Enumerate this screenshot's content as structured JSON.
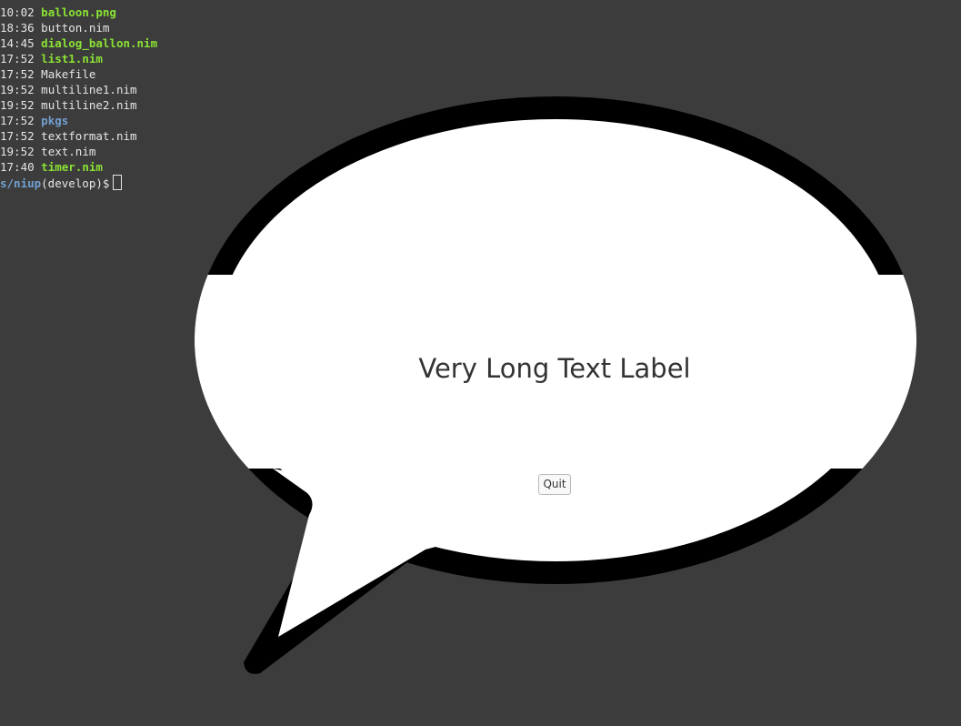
{
  "terminal": {
    "lines": [
      {
        "time": "10:02",
        "name": "balloon.png",
        "kind": "exec"
      },
      {
        "time": "18:36",
        "name": "button.nim",
        "kind": "plain"
      },
      {
        "time": "14:45",
        "name": "dialog_ballon.nim",
        "kind": "exec"
      },
      {
        "time": "17:52",
        "name": "list1.nim",
        "kind": "exec"
      },
      {
        "time": "17:52",
        "name": "Makefile",
        "kind": "plain"
      },
      {
        "time": "19:52",
        "name": "multiline1.nim",
        "kind": "plain"
      },
      {
        "time": "19:52",
        "name": "multiline2.nim",
        "kind": "plain"
      },
      {
        "time": "17:52",
        "name": "pkgs",
        "kind": "dir"
      },
      {
        "time": "17:52",
        "name": "textformat.nim",
        "kind": "plain"
      },
      {
        "time": "19:52",
        "name": "text.nim",
        "kind": "plain"
      },
      {
        "time": "17:40",
        "name": "timer.nim",
        "kind": "exec"
      }
    ],
    "prompt_path": "s/niup",
    "prompt_rest": "(develop)$"
  },
  "dialog": {
    "label": "Very Long Text Label",
    "quit_label": "Quit"
  },
  "colors": {
    "background": "#3c3c3c",
    "exec_file": "#8ae234",
    "directory": "#729fcf",
    "balloon_fill": "#ffffff",
    "balloon_outline": "#000000"
  }
}
